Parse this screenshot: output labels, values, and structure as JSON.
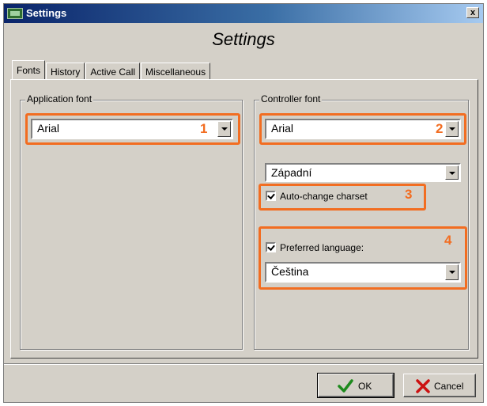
{
  "window": {
    "title": "Settings",
    "header_title": "Settings",
    "close_glyph": "x"
  },
  "tabs": [
    {
      "label": "Fonts",
      "active": true
    },
    {
      "label": "History",
      "active": false
    },
    {
      "label": "Active Call",
      "active": false
    },
    {
      "label": "Miscellaneous",
      "active": false
    }
  ],
  "application_font": {
    "group_label": "Application font",
    "font_value": "Arial",
    "marker": "1"
  },
  "controller_font": {
    "group_label": "Controller font",
    "font_value": "Arial",
    "font_marker": "2",
    "charset_value": "Západní",
    "auto_change_charset": {
      "label": "Auto-change charset",
      "checked": true,
      "marker": "3"
    },
    "preferred_language": {
      "label": "Preferred language:",
      "checked": true,
      "value": "Čeština",
      "marker": "4"
    }
  },
  "buttons": {
    "ok_label": "OK",
    "cancel_label": "Cancel"
  },
  "colors": {
    "highlight": "#f26d21",
    "ok_check": "#1d8a1d",
    "cancel_x": "#cc1111"
  },
  "icons": [
    "app-icon",
    "close-icon",
    "dropdown-arrow-icon",
    "checkbox-check-icon",
    "checkmark-icon",
    "x-icon"
  ]
}
